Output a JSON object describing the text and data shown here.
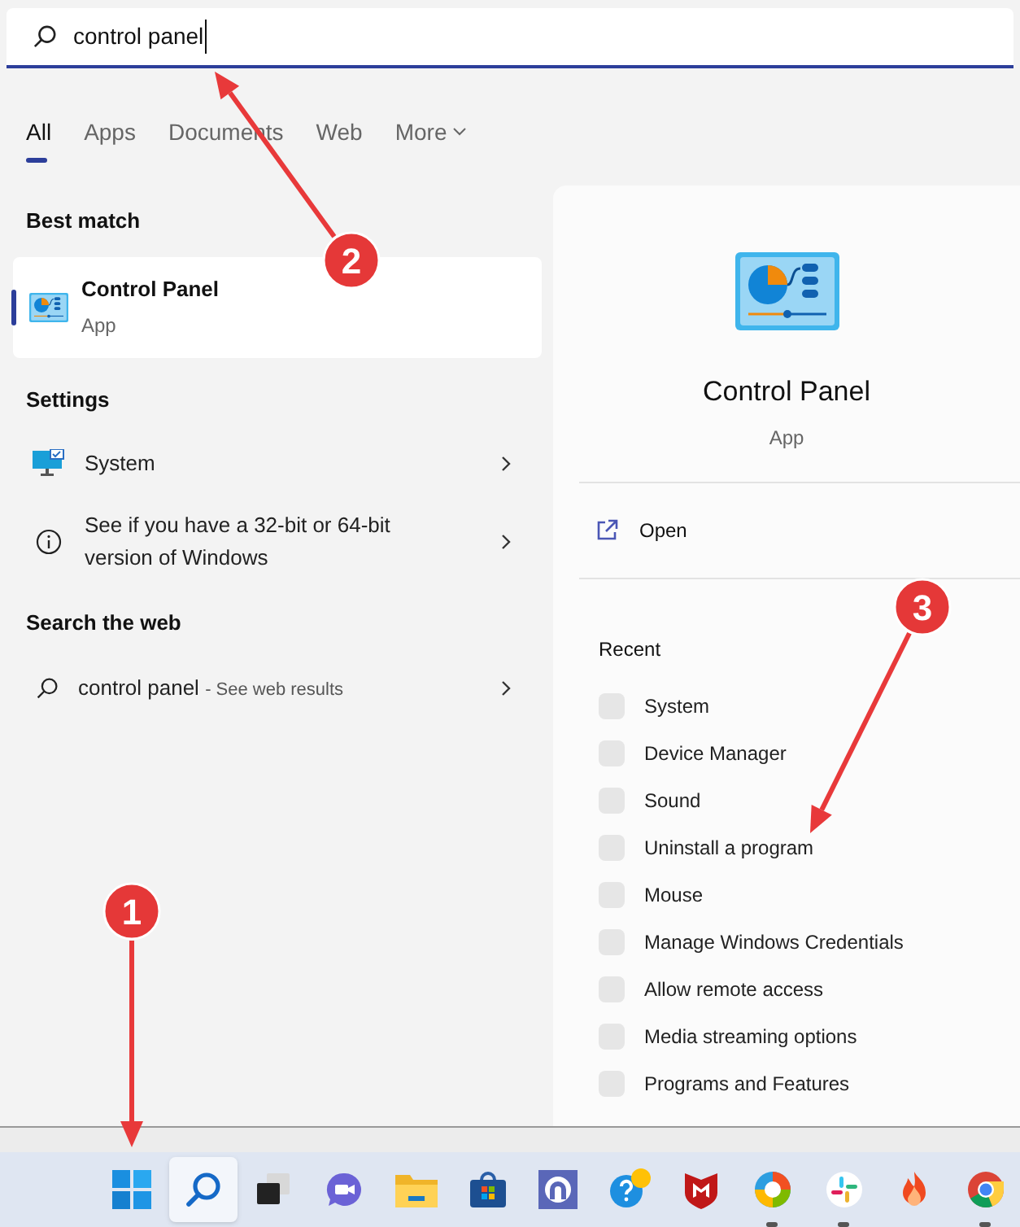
{
  "search": {
    "value": "control panel"
  },
  "tabs": [
    {
      "label": "All",
      "selected": true
    },
    {
      "label": "Apps",
      "selected": false
    },
    {
      "label": "Documents",
      "selected": false
    },
    {
      "label": "Web",
      "selected": false
    },
    {
      "label": "More",
      "selected": false,
      "dropdown": true
    }
  ],
  "best_match": {
    "heading": "Best match",
    "title": "Control Panel",
    "subtitle": "App",
    "selected": true
  },
  "settings": {
    "heading": "Settings",
    "items": [
      {
        "kind": "monitor",
        "label": "System"
      },
      {
        "kind": "info",
        "label": "See if you have a 32-bit or 64-bit version of Windows"
      }
    ]
  },
  "web": {
    "heading": "Search the web",
    "query": "control panel",
    "hint": "- See web results"
  },
  "preview": {
    "title": "Control Panel",
    "subtitle": "App",
    "action": "Open",
    "recent_heading": "Recent",
    "recent": [
      "System",
      "Device Manager",
      "Sound",
      "Uninstall a program",
      "Mouse",
      "Manage Windows Credentials",
      "Allow remote access",
      "Media streaming options",
      "Programs and Features"
    ]
  },
  "taskbar": [
    {
      "kind": "start",
      "active": false,
      "running": false
    },
    {
      "kind": "search",
      "active": true,
      "running": false
    },
    {
      "kind": "taskview",
      "active": false,
      "running": false
    },
    {
      "kind": "chat",
      "active": false,
      "running": false
    },
    {
      "kind": "folder",
      "active": false,
      "running": false
    },
    {
      "kind": "store",
      "active": false,
      "running": false
    },
    {
      "kind": "app",
      "active": false,
      "running": false
    },
    {
      "kind": "help",
      "active": false,
      "running": false
    },
    {
      "kind": "shield",
      "active": false,
      "running": false
    },
    {
      "kind": "edge",
      "active": false,
      "running": true
    },
    {
      "kind": "slack",
      "active": false,
      "running": true
    },
    {
      "kind": "flame",
      "active": false,
      "running": false
    },
    {
      "kind": "chrome",
      "active": false,
      "running": true
    }
  ],
  "annotations": [
    {
      "label": "1"
    },
    {
      "label": "2"
    },
    {
      "label": "3"
    }
  ]
}
